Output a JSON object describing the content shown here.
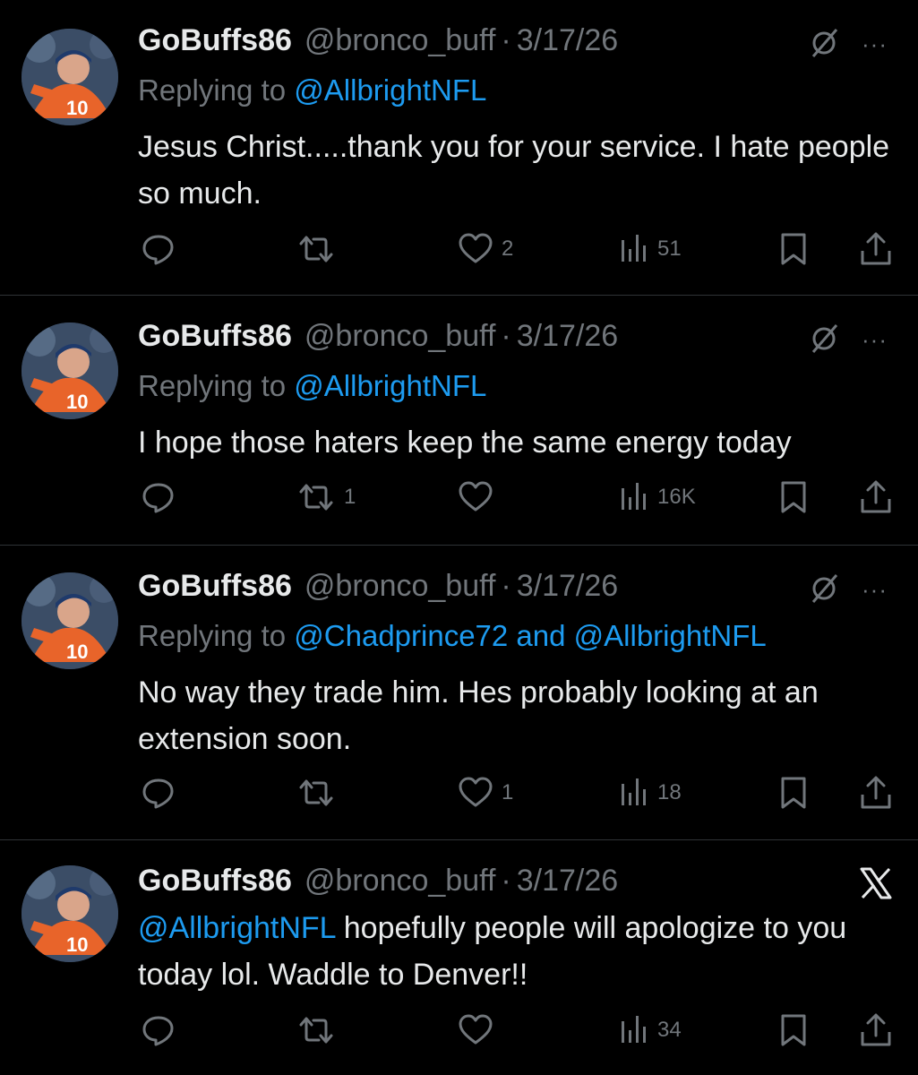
{
  "colors": {
    "background": "#000000",
    "text": "#e7e9ea",
    "muted": "#71767b",
    "link": "#1d9bf0",
    "divider": "#2f3336"
  },
  "tweets": [
    {
      "display_name": "GoBuffs86",
      "handle": "@bronco_buff",
      "separator": "·",
      "date": "3/17/26",
      "reply_prefix": "Replying to",
      "reply_mentions": "@AllbrightNFL",
      "text": "Jesus Christ.....thank you for your service. I hate people so much.",
      "replies": "",
      "reposts": "",
      "likes": "2",
      "views": "51",
      "top_icon": "hidden-slash-icon"
    },
    {
      "display_name": "GoBuffs86",
      "handle": "@bronco_buff",
      "separator": "·",
      "date": "3/17/26",
      "reply_prefix": "Replying to",
      "reply_mentions": "@AllbrightNFL",
      "text": "I hope those haters keep the same energy today",
      "replies": "",
      "reposts": "1",
      "likes": "",
      "views": "16K",
      "top_icon": "hidden-slash-icon"
    },
    {
      "display_name": "GoBuffs86",
      "handle": "@bronco_buff",
      "separator": "·",
      "date": "3/17/26",
      "reply_prefix": "Replying to",
      "reply_mentions": "@Chadprince72 and @AllbrightNFL",
      "text": "No way they trade him. Hes probably looking at an extension soon.",
      "replies": "",
      "reposts": "",
      "likes": "1",
      "views": "18",
      "top_icon": "hidden-slash-icon"
    },
    {
      "display_name": "GoBuffs86",
      "handle": "@bronco_buff",
      "separator": "·",
      "date": "3/17/26",
      "mention": "@AllbrightNFL",
      "text": " hopefully people will apologize to you today lol. Waddle to Denver!!",
      "replies": "",
      "reposts": "",
      "likes": "",
      "views": "34",
      "top_icon": "x-logo-icon"
    }
  ],
  "more_glyph": "···"
}
